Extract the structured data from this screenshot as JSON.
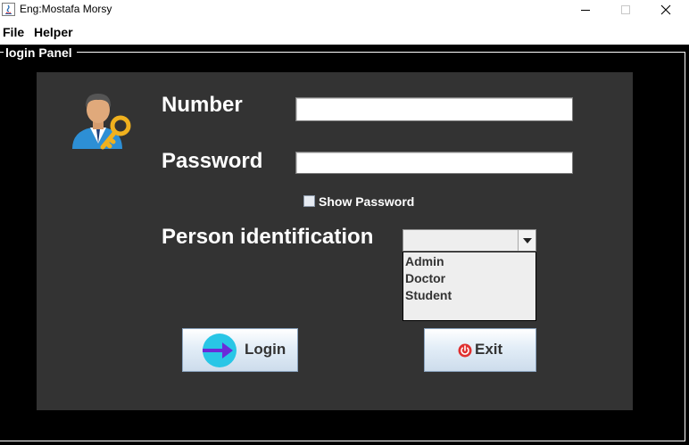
{
  "window": {
    "title": "Eng:Mostafa Morsy"
  },
  "menu": {
    "items": [
      {
        "label": "File"
      },
      {
        "label": "Helper"
      }
    ]
  },
  "panel": {
    "legend": "login Panel",
    "number_label": "Number",
    "number_value": "",
    "password_label": "Password",
    "password_value": "",
    "show_password_label": "Show Password",
    "show_password_checked": false,
    "person_label": "Person identification",
    "combo_selected": "",
    "combo_options": [
      "Admin",
      "Doctor",
      "Student"
    ],
    "login_label": "Login",
    "exit_label": "Exit"
  },
  "colors": {
    "frame_bg": "#000000",
    "panel_bg": "#333333",
    "label_text": "#ffffff",
    "login_icon_circle": "#29c6e6",
    "login_icon_arrow": "#6b2bd9",
    "exit_icon": "#e03030"
  },
  "icons": [
    "java-app-icon",
    "user-key-icon",
    "dropdown-arrow-icon",
    "arrow-right-icon",
    "power-icon"
  ]
}
